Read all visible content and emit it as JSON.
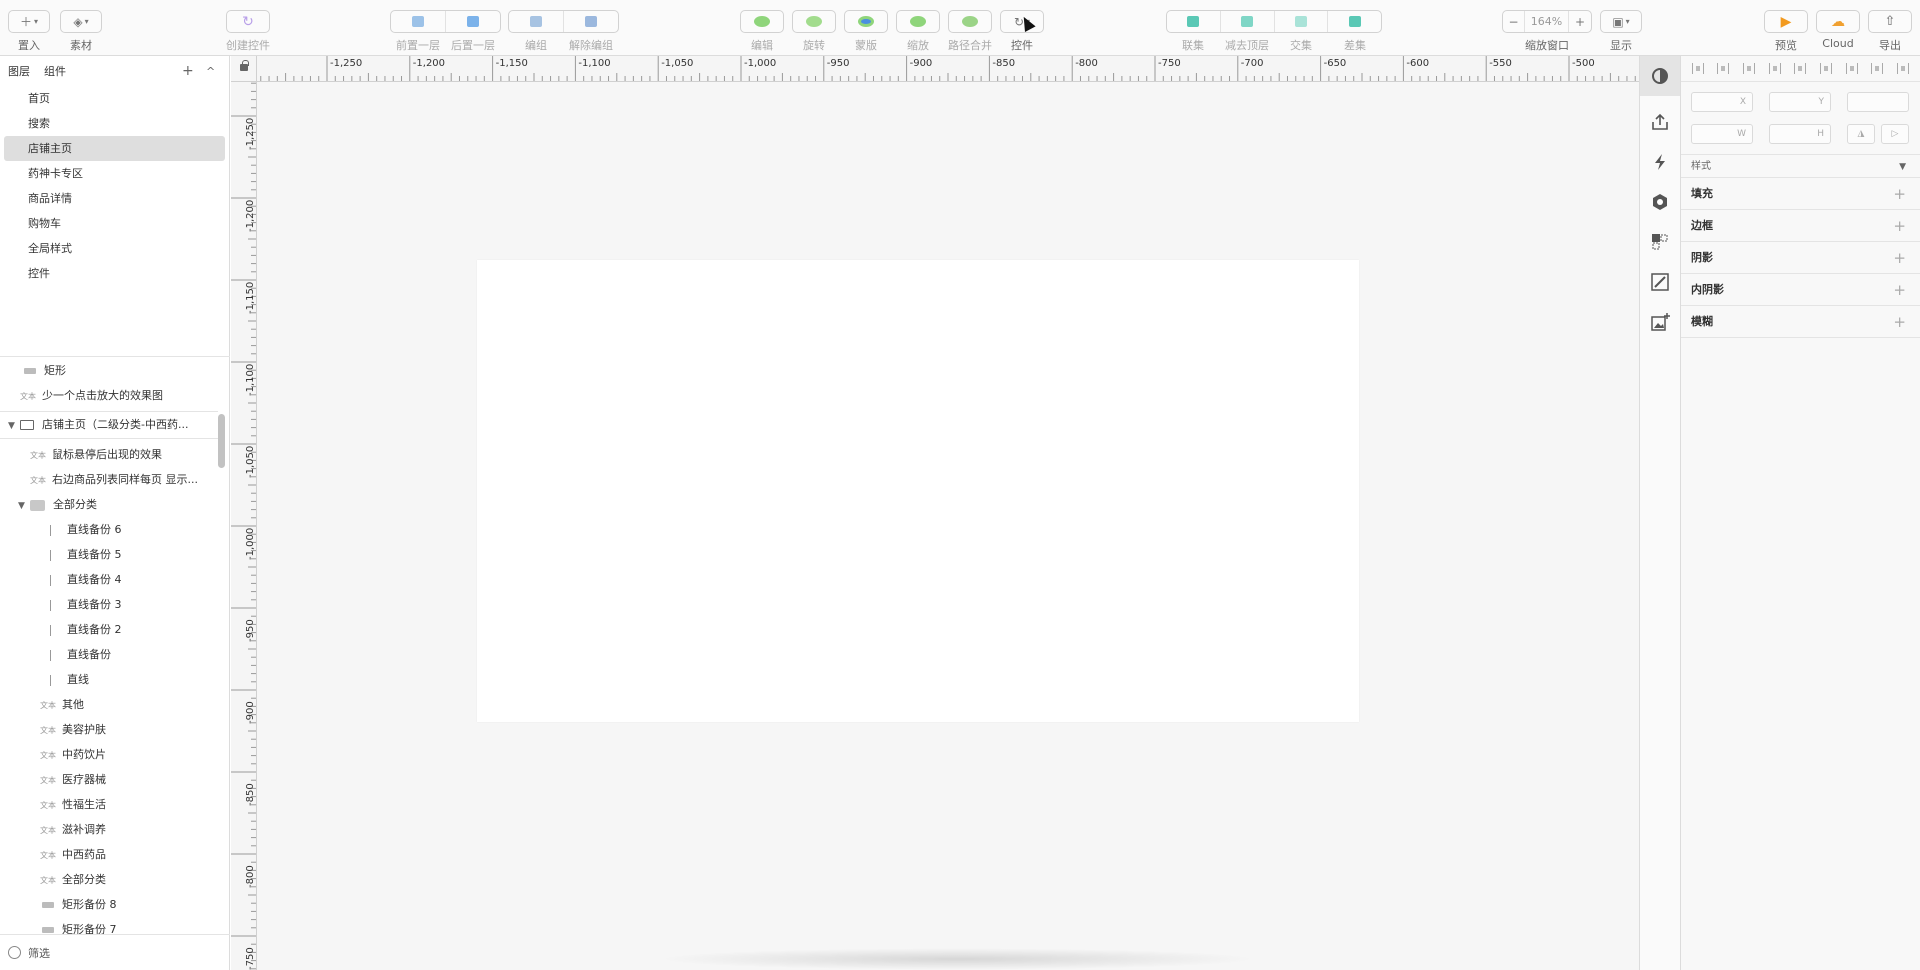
{
  "toolbar": {
    "insert": {
      "label": "置入",
      "icon": "plus-icon"
    },
    "material": {
      "label": "素材",
      "icon": "layers-icon"
    },
    "create_component": {
      "label": "创建控件"
    },
    "bring_forward": {
      "label": "前置一层"
    },
    "send_backward": {
      "label": "后置一层"
    },
    "group": {
      "label": "编组"
    },
    "ungroup": {
      "label": "解除编组"
    },
    "edit": {
      "label": "编辑"
    },
    "rotate": {
      "label": "旋转"
    },
    "mask": {
      "label": "蒙版"
    },
    "scale": {
      "label": "缩放"
    },
    "path_merge": {
      "label": "路径合并"
    },
    "component": {
      "label": "控件"
    },
    "union": {
      "label": "联集"
    },
    "subtract": {
      "label": "减去顶层"
    },
    "intersect": {
      "label": "交集"
    },
    "difference": {
      "label": "差集"
    },
    "zoom": {
      "label": "缩放窗口",
      "value": "164%",
      "minus": "−",
      "plus": "+"
    },
    "display": {
      "label": "显示"
    },
    "preview": {
      "label": "预览"
    },
    "cloud": {
      "label": "Cloud"
    },
    "export": {
      "label": "导出"
    }
  },
  "left_panel": {
    "tabs": [
      "图层",
      "组件"
    ],
    "add": "+",
    "collapse": "^",
    "pages": [
      {
        "name": "首页"
      },
      {
        "name": "搜索"
      },
      {
        "name": "店铺主页"
      },
      {
        "name": "药神卡专区"
      },
      {
        "name": "商品详情"
      },
      {
        "name": "购物车"
      },
      {
        "name": "全局样式"
      },
      {
        "name": "控件"
      }
    ],
    "selected_page": "店铺主页",
    "text_badge": "文本",
    "layers": [
      {
        "type": "rect",
        "name": "矩形"
      },
      {
        "type": "text",
        "name": "少一个点击放大的效果图"
      },
      {
        "type": "artboard",
        "name": "店铺主页（二级分类-中西药..."
      },
      {
        "type": "text",
        "name": "鼠标悬停后出现的效果"
      },
      {
        "type": "text",
        "name": "右边商品列表同样每页 显示..."
      },
      {
        "type": "folder",
        "name": "全部分类"
      },
      {
        "type": "line",
        "name": "直线备份 6"
      },
      {
        "type": "line",
        "name": "直线备份 5"
      },
      {
        "type": "line",
        "name": "直线备份 4"
      },
      {
        "type": "line",
        "name": "直线备份 3"
      },
      {
        "type": "line",
        "name": "直线备份 2"
      },
      {
        "type": "line",
        "name": "直线备份"
      },
      {
        "type": "line",
        "name": "直线"
      },
      {
        "type": "text",
        "name": "其他"
      },
      {
        "type": "text",
        "name": "美容护肤"
      },
      {
        "type": "text",
        "name": "中药饮片"
      },
      {
        "type": "text",
        "name": "医疗器械"
      },
      {
        "type": "text",
        "name": "性福生活"
      },
      {
        "type": "text",
        "name": "滋补调养"
      },
      {
        "type": "text",
        "name": "中西药品"
      },
      {
        "type": "text",
        "name": "全部分类"
      },
      {
        "type": "rect",
        "name": "矩形备份 8"
      },
      {
        "type": "rect",
        "name": "矩形备份 7"
      }
    ],
    "filter": "筛选"
  },
  "rulers": {
    "top": [
      "-1,250",
      "-1,200",
      "-1,150",
      "-1,100",
      "-1,050",
      "-1,000",
      "-950",
      "-900",
      "-850",
      "-800",
      "-750",
      "-700",
      "-650",
      "-600",
      "-550",
      "-500"
    ],
    "left": [
      "-1,250",
      "-1,200",
      "-1,150",
      "-1,100",
      "-1,050",
      "-1,000",
      "-950",
      "-900",
      "-850",
      "-800",
      "-750"
    ]
  },
  "icon_bar": [
    "contrast-icon",
    "upload-icon",
    "lightning-icon",
    "hexagon-icon",
    "component-slice-icon",
    "edit-image-icon",
    "add-image-icon"
  ],
  "inspector": {
    "x_label": "X",
    "y_label": "Y",
    "w_label": "W",
    "h_label": "H",
    "style": "样式",
    "sections": [
      "填充",
      "边框",
      "阴影",
      "内阴影",
      "模糊"
    ],
    "plus": "+"
  },
  "colors": {
    "preview_orange": "#f29a1f",
    "cloud_orange": "#f0a030",
    "edit_green": "#8fd57b",
    "mask_blue": "#4b8fe0",
    "bool_teal": "#5ac8b5",
    "create_purple": "#b89fe8"
  }
}
